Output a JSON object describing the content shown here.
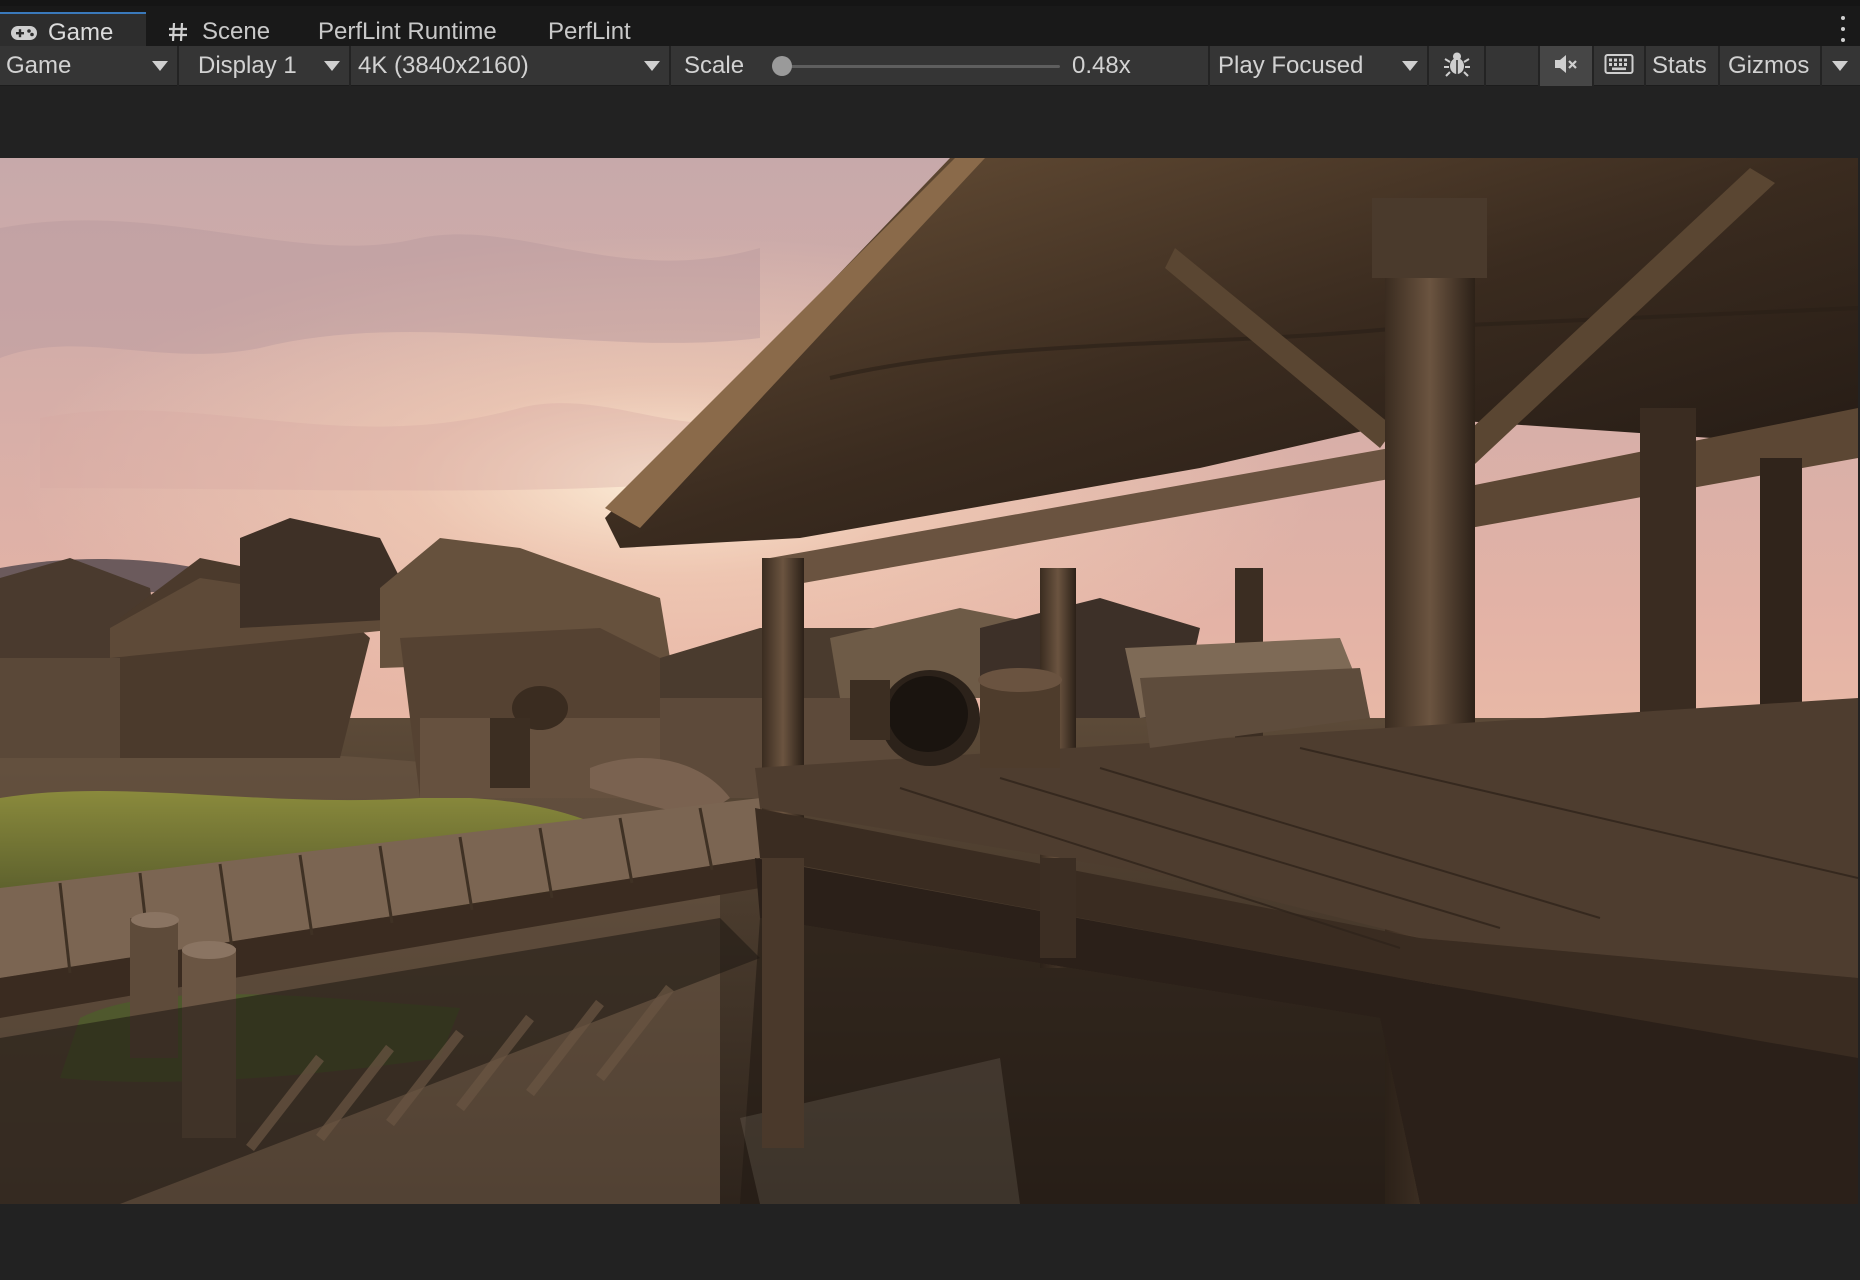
{
  "tabs": [
    {
      "label": "Game",
      "icon": "gamepad-icon",
      "active": true
    },
    {
      "label": "Scene",
      "icon": "hash-icon",
      "active": false
    },
    {
      "label": "PerfLint Runtime",
      "active": false
    },
    {
      "label": "PerfLint",
      "active": false
    }
  ],
  "toolbar": {
    "view_mode": "Game",
    "display": "Display 1",
    "resolution": "4K (3840x2160)",
    "scale_label": "Scale",
    "scale_value": "0.48x",
    "scale_fraction": 0.0,
    "play_mode": "Play Focused",
    "stats_label": "Stats",
    "gizmos_label": "Gizmos",
    "icons": {
      "bug": "bug-icon",
      "mute": "mute-audio-icon",
      "keyboard": "keyboard-shortcuts-icon",
      "menu": "kebab-menu-icon"
    }
  },
  "colors": {
    "accent": "#3a79bb",
    "toolbar_bg": "#353535",
    "tab_bg": "#191919",
    "panel_bg": "#222222"
  }
}
